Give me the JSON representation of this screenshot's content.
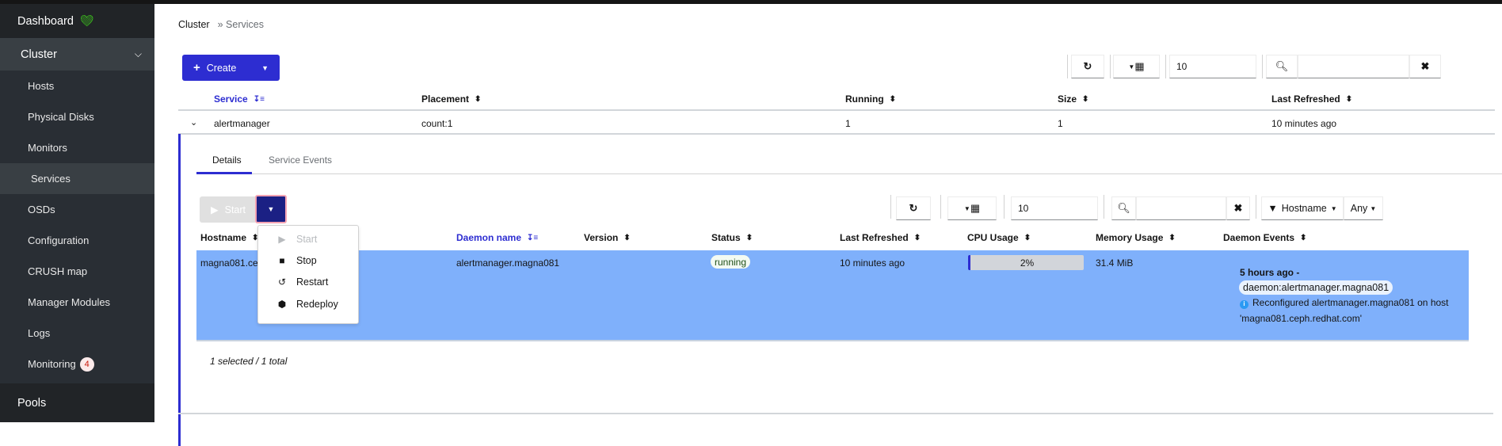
{
  "sidebar": {
    "dashboard": {
      "label": "Dashboard",
      "icon": "heartbeat-icon"
    },
    "cluster": {
      "label": "Cluster",
      "expanded": true
    },
    "cluster_items": [
      {
        "label": "Hosts"
      },
      {
        "label": "Physical Disks"
      },
      {
        "label": "Monitors"
      },
      {
        "label": "Services",
        "active": true
      },
      {
        "label": "OSDs"
      },
      {
        "label": "Configuration"
      },
      {
        "label": "CRUSH map"
      },
      {
        "label": "Manager Modules"
      },
      {
        "label": "Logs"
      },
      {
        "label": "Monitoring",
        "badge": "4"
      }
    ],
    "pools": {
      "label": "Pools"
    }
  },
  "breadcrumb": {
    "parent": "Cluster",
    "separator": "»",
    "current": "Services"
  },
  "toolbar": {
    "create_label": "Create",
    "page_size": "10",
    "search_placeholder": ""
  },
  "services_table": {
    "columns": [
      {
        "label": "Service",
        "sorted": true
      },
      {
        "label": "Placement"
      },
      {
        "label": "Running"
      },
      {
        "label": "Size"
      },
      {
        "label": "Last Refreshed"
      }
    ],
    "rows": [
      {
        "service": "alertmanager",
        "placement": "count:1",
        "running": "1",
        "size": "1",
        "last_refreshed": "10 minutes ago",
        "expanded": true
      }
    ]
  },
  "details": {
    "tabs": [
      {
        "label": "Details",
        "active": true
      },
      {
        "label": "Service Events"
      }
    ],
    "start_label": "Start",
    "page_size": "10",
    "search_placeholder": "",
    "filter_field": "Hostname",
    "filter_value": "Any",
    "dropdown_menu": [
      {
        "label": "Start",
        "icon": "play-icon",
        "disabled": true
      },
      {
        "label": "Stop",
        "icon": "stop-icon"
      },
      {
        "label": "Restart",
        "icon": "history-icon"
      },
      {
        "label": "Redeploy",
        "icon": "cube-icon"
      }
    ],
    "columns": [
      {
        "label": "Hostname"
      },
      {
        "label": "Daemon name",
        "sorted": true
      },
      {
        "label": "Version"
      },
      {
        "label": "Status"
      },
      {
        "label": "Last Refreshed"
      },
      {
        "label": "CPU Usage"
      },
      {
        "label": "Memory Usage"
      },
      {
        "label": "Daemon Events"
      }
    ],
    "rows": [
      {
        "hostname": "magna081.ceph.redhat.com",
        "daemon_name": "alertmanager.magna081",
        "version": "",
        "status": "running",
        "last_refreshed": "10 minutes ago",
        "cpu_usage": "2%",
        "cpu_usage_fraction": 0.02,
        "memory_usage": "31.4 MiB",
        "event_time": "5 hours ago -",
        "event_subject": "daemon:alertmanager.magna081",
        "event_message": "Reconfigured alertmanager.magna081 on host 'magna081.ceph.redhat.com'",
        "selected": true
      }
    ],
    "footer": "1 selected / 1 total"
  },
  "colors": {
    "accent": "#2d2dd1",
    "selected_row": "#7fb0fb",
    "sidebar_bg": "#292e34",
    "health_ok": "#3ec51e",
    "badge_text": "#c9190b"
  }
}
